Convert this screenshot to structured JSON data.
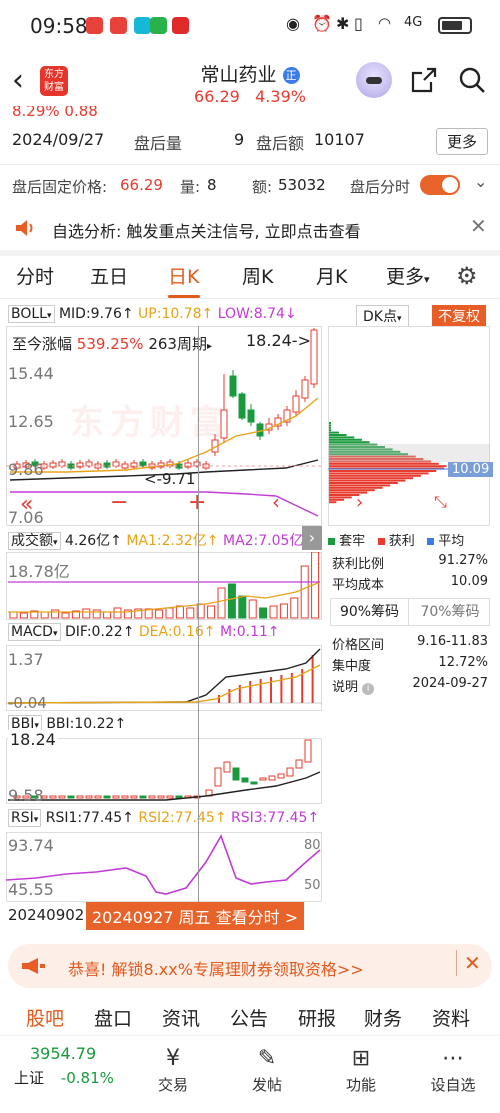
{
  "status_bar": {
    "time": "09:58",
    "signal": "4G"
  },
  "header": {
    "back_icon": "chevron-left-icon",
    "app_logo_line1": "东方",
    "app_logo_line2": "财富",
    "stock_name": "常山药业",
    "stock_badge": "正",
    "price": "66.29",
    "change_pct": "4.39%"
  },
  "info": {
    "partial_row": "8.29%  0.88",
    "date": "2024/09/27",
    "after_hours_volume_label": "盘后量",
    "after_hours_volume": "9",
    "after_hours_amount_label": "盘后额",
    "after_hours_amount": "10107",
    "more_label": "更多",
    "fixed_price_label": "盘后固定价格:",
    "fixed_price": "66.29",
    "volume_label": "量:",
    "volume": "8",
    "amount_label": "额:",
    "amount": "53032",
    "timeshare_label": "盘后分时"
  },
  "alert": {
    "text": "自选分析: 触发重点关注信号, 立即点击查看"
  },
  "tabs": [
    {
      "label": "分时"
    },
    {
      "label": "五日"
    },
    {
      "label": "日K",
      "active": true
    },
    {
      "label": "周K"
    },
    {
      "label": "月K"
    },
    {
      "label": "更多"
    }
  ],
  "boll": {
    "name": "BOLL",
    "mid": "MID:9.76↑",
    "up": "UP:10.78↑",
    "low": "LOW:8.74↓",
    "dk_label": "DK点",
    "fq_label": "不复权",
    "gain_label": "至今涨幅",
    "gain_value": "539.25%",
    "period": "263周期",
    "max_label": "18.24->",
    "y_top": "15.44",
    "y_mid": "12.65",
    "y_low": "9.86",
    "y_bottom": "7.06",
    "min_label": "<-9.71",
    "watermark": "东方财富",
    "cost_label": "10.09"
  },
  "volume": {
    "name": "成交额",
    "value": "4.26亿↑",
    "ma1": "MA1:2.32亿↑",
    "ma2": "MA2:7.05亿↓",
    "y_top": "18.78亿"
  },
  "macd": {
    "name": "MACD",
    "dif": "DIF:0.22↑",
    "dea": "DEA:0.16↑",
    "m": "M:0.11↑",
    "y_top": "1.37",
    "y_bottom": "-0.04"
  },
  "bbi": {
    "name": "BBI",
    "value": "BBI:10.22↑",
    "y_top": "18.24",
    "y_bottom": "9.58"
  },
  "rsi": {
    "name": "RSI",
    "rsi1": "RSI1:77.45↑",
    "rsi2": "RSI2:77.45↑",
    "rsi3": "RSI3:77.45↑",
    "y_top": "93.74",
    "y_bottom": "45.55",
    "r80": "80",
    "r50": "50"
  },
  "date_axis": {
    "start": "20240902",
    "selected": "20240927 周五 查看分时 >"
  },
  "chip": {
    "legend_trapped": "套牢",
    "legend_profit": "获利",
    "legend_avg": "平均",
    "profit_ratio_label": "获利比例",
    "profit_ratio": "91.27%",
    "avg_cost_label": "平均成本",
    "avg_cost": "10.09",
    "tab_90": "90%筹码",
    "tab_70": "70%筹码",
    "range_label": "价格区间",
    "range": "9.16-11.83",
    "concentration_label": "集中度",
    "concentration": "12.72%",
    "note_label": "说明",
    "note_date": "2024-09-27"
  },
  "banner": {
    "text": "恭喜! 解锁8.xx%专属理财券领取资格>>"
  },
  "bottom_tabs": [
    "股吧",
    "盘口",
    "资讯",
    "公告",
    "研报",
    "财务",
    "资料"
  ],
  "bottom_bar": {
    "index_value": "3954.79",
    "index_name": "上证",
    "index_change": "-0.81%",
    "items": [
      "交易",
      "发帖",
      "功能",
      "设自选"
    ]
  },
  "colors": {
    "accent": "#e25a1c",
    "up": "#e63b2e",
    "down": "#1a9a3c",
    "ma_yellow": "#e8a317",
    "ma_purple": "#c23bd6"
  }
}
